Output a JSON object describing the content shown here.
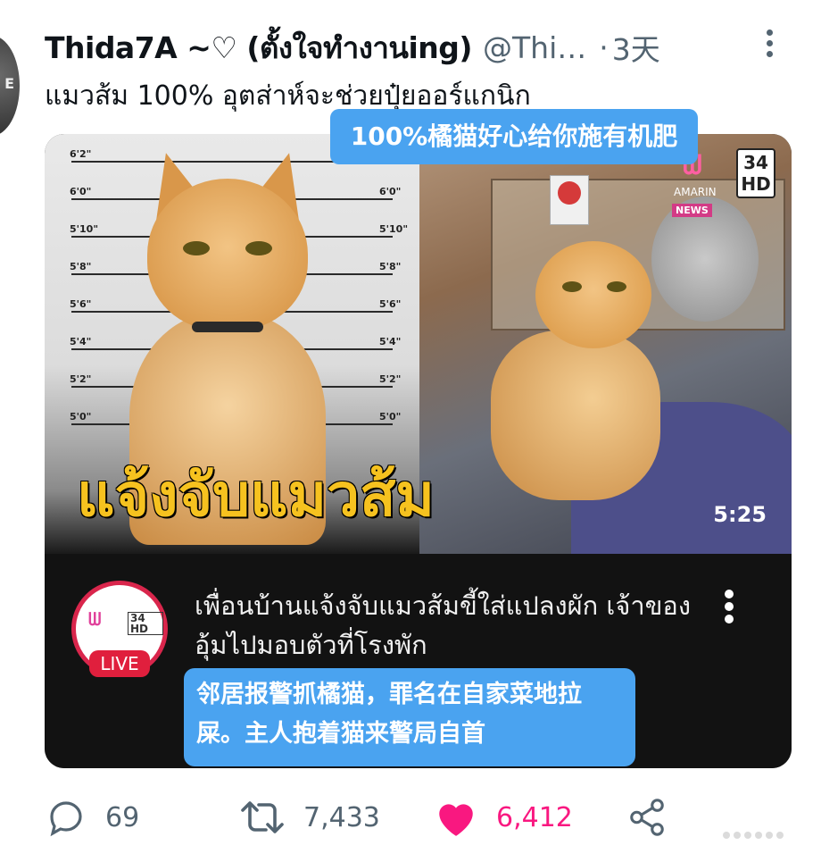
{
  "author": {
    "display_name": "Thida7A ~♡ (ตั้งใจทำงานing)",
    "handle": "@Thi…",
    "separator": "·",
    "time": "3天"
  },
  "tweet": {
    "text": "แมวส้ม 100% อุตส่าห์จะช่วยปุ๋ยออร์แกนิก"
  },
  "overlays": {
    "top": "100%橘猫好心给你施有机肥",
    "bottom": "邻居报警抓橘猫，罪名在自家菜地拉屎。主人抱着猫来警局自首"
  },
  "video": {
    "banner_text": "แจ้งจับแมวส้ม",
    "duration": "5:25",
    "title": "เพื่อนบ้านแจ้งจับแมวส้มขี้ใส่แปลงผัก เจ้าของอุ้มไปมอบตัวที่โรงพัก",
    "channel_badge": "LIVE",
    "channel_brand": "AMARIN",
    "channel_number": "34 HD",
    "news_tag": "NEWS",
    "height_labels": [
      "6'2\"",
      "6'0\"",
      "5'10\"",
      "5'8\"",
      "5'6\"",
      "5'4\"",
      "5'2\"",
      "5'0\""
    ]
  },
  "actions": {
    "replies": "69",
    "retweets": "7,433",
    "likes": "6,412"
  },
  "icons": {
    "reply": "reply-icon",
    "retweet": "retweet-icon",
    "like": "heart-icon",
    "share": "share-icon",
    "more": "more-vertical-icon"
  },
  "colors": {
    "like": "#f91880",
    "secondary_text": "#536471",
    "overlay_blue": "#4aa3f0",
    "banner_yellow": "#f6c21f",
    "live_red": "#e01f3d"
  }
}
